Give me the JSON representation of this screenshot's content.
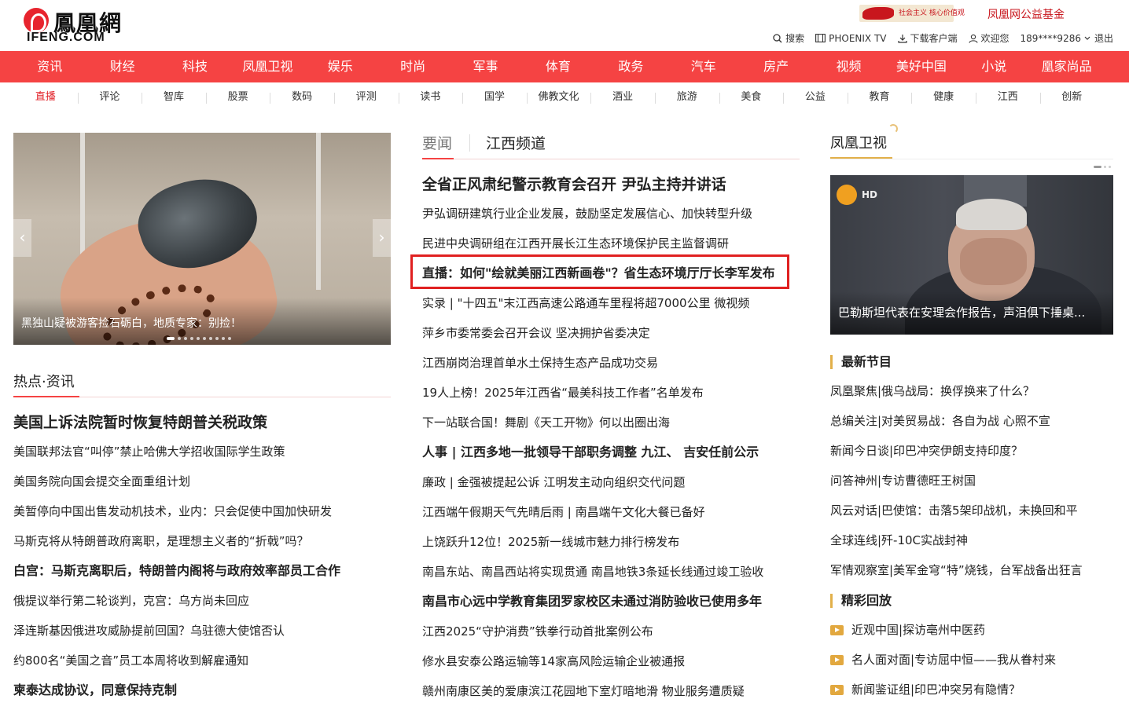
{
  "header": {
    "logo_cn": "鳳凰網",
    "logo_en": "IFENG.COM",
    "banner_left_text": "社会主义 核心价值观",
    "banner_right_text": "凤凰网公益基金",
    "toolbar": {
      "search": "搜索",
      "phoenix_tv": "PHOENIX TV",
      "download": "下载客户端",
      "welcome": "欢迎您",
      "user": "189****9286",
      "logout": "退出"
    }
  },
  "nav_main": [
    "资讯",
    "财经",
    "科技",
    "凤凰卫视",
    "娱乐",
    "时尚",
    "军事",
    "体育",
    "政务",
    "汽车",
    "房产",
    "视频",
    "美好中国",
    "小说",
    "凰家尚品"
  ],
  "nav_sub": [
    "直播",
    "评论",
    "智库",
    "股票",
    "数码",
    "评测",
    "读书",
    "国学",
    "佛教文化",
    "酒业",
    "旅游",
    "美食",
    "公益",
    "教育",
    "健康",
    "江西",
    "创新"
  ],
  "slider": {
    "caption": "黑独山疑被游客捡石砺白，地质专家：别捡！",
    "prev": "‹",
    "next": "›"
  },
  "hot": {
    "title": "热点·资讯",
    "items": [
      "美国上诉法院暂时恢复特朗普关税政策",
      "美国联邦法官“叫停”禁止哈佛大学招收国际学生政策",
      "美国务院向国会提交全面重组计划",
      "美暂停向中国出售发动机技术，业内：只会促使中国加快研发",
      "马斯克将从特朗普政府离职，是理想主义者的“折戟”吗？",
      "白宫：马斯克离职后，特朗普内阁将与政府效率部员工合作",
      "俄提议举行第二轮谈判，克宫：乌方尚未回应",
      "泽连斯基因俄进攻威胁提前回国？乌驻德大使馆否认",
      "约800名“美国之音”员工本周将收到解雇通知",
      "柬泰达成协议，同意保持克制"
    ]
  },
  "center": {
    "tab_news": "要闻",
    "tab_jiangxi": "江西频道",
    "items": [
      "全省正风肃纪警示教育会召开 尹弘主持并讲话",
      "尹弘调研建筑行业企业发展，鼓励坚定发展信心、加快转型升级",
      "民进中央调研组在江西开展长江生态环境保护民主监督调研",
      "直播：如何\"绘就美丽江西新画卷\"？省生态环境厅厅长李军发布",
      "实录 | \"十四五\"末江西高速公路通车里程将超7000公里   微视频",
      "萍乡市委常委会召开会议 坚决拥护省委决定",
      "江西崩岗治理首单水土保持生态产品成功交易",
      "19人上榜！2025年江西省“最美科技工作者”名单发布",
      "下一站联合国！舞剧《天工开物》何以出圈出海",
      "人事 |   江西多地一批领导干部职务调整   九江、   吉安任前公示",
      "廉政 |   金强被提起公诉    江明发主动向组织交代问题",
      "江西端午假期天气先晴后雨    | 南昌端午文化大餐已备好",
      "上饶跃升12位！2025新一线城市魅力排行榜发布",
      "南昌东站、南昌西站将实现贯通    南昌地铁3条延长线通过竣工验收",
      "南昌市心远中学教育集团罗家校区未通过消防验收已使用多年",
      "江西2025“守护消费”铁拳行动首批案例公布",
      "修水县安泰公路运输等14家高风险运输企业被通报",
      "赣州南康区美的爱康滨江花园地下室灯暗地滑 物业服务遭质疑"
    ]
  },
  "right": {
    "tv_title": "凤凰卫视",
    "video_badge": "HD",
    "video_caption": "巴勒斯坦代表在安理会作报告，声泪俱下捶桌...",
    "latest_title": "最新节目",
    "latest_items": [
      "凤凰聚焦|俄乌战局：换俘换来了什么？",
      "总编关注|对美贸易战：各自为战 心照不宣",
      "新闻今日谈|印巴冲突伊朗支持印度？",
      "问答神州|专访曹德旺王树国",
      "风云对话|巴使馆：击落5架印战机，未换回和平",
      "全球连线|歼-10C实战封神",
      "军情观察室|美军金穹“特”烧钱，台军战备出狂言"
    ],
    "replay_title": "精彩回放",
    "replay_items": [
      "近观中国|探访亳州中医药",
      "名人面对面|专访屈中恒——我从眷村来",
      "新闻鉴证组|印巴冲突另有隐情？"
    ]
  },
  "colors": {
    "brand_red": "#f54343",
    "highlight_red": "#e02020",
    "accent_gold": "#e2b04a"
  }
}
